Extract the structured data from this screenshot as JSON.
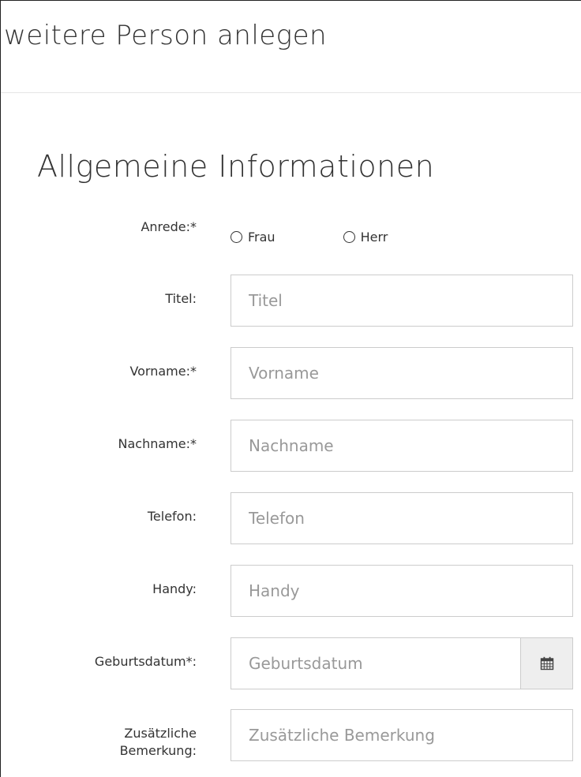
{
  "modal": {
    "title": "weitere Person anlegen"
  },
  "section": {
    "title": "Allgemeine Informationen"
  },
  "form": {
    "salutation": {
      "label": "Anrede:*",
      "options": [
        "Frau",
        "Herr"
      ]
    },
    "title": {
      "label": "Titel:",
      "placeholder": "Titel",
      "value": ""
    },
    "firstname": {
      "label": "Vorname:*",
      "placeholder": "Vorname",
      "value": ""
    },
    "lastname": {
      "label": "Nachname:*",
      "placeholder": "Nachname",
      "value": ""
    },
    "phone": {
      "label": "Telefon:",
      "placeholder": "Telefon",
      "value": ""
    },
    "mobile": {
      "label": "Handy:",
      "placeholder": "Handy",
      "value": ""
    },
    "birthdate": {
      "label": "Geburtsdatum*:",
      "placeholder": "Geburtsdatum",
      "value": "",
      "icon": "calendar-icon"
    },
    "remark": {
      "label_line1": "Zusätzliche",
      "label_line2": "Bemerkung:",
      "placeholder": "Zusätzliche Bemerkung",
      "value": ""
    }
  }
}
